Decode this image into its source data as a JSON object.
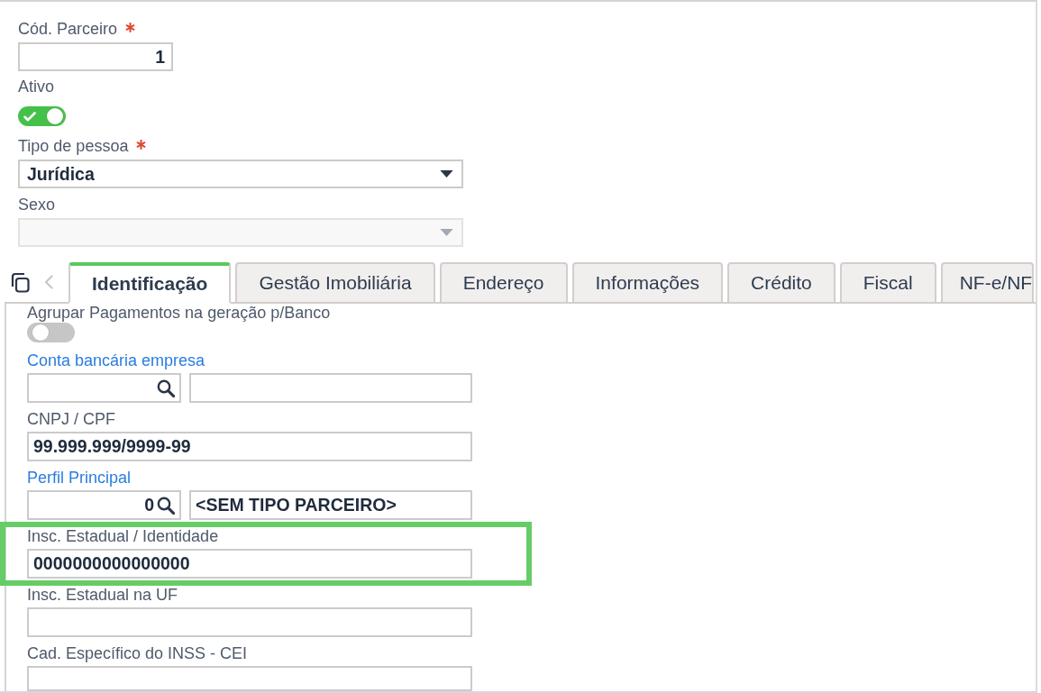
{
  "header_fields": [
    {
      "kind": "number",
      "label": "Cód. Parceiro",
      "required": true,
      "value": "1"
    },
    {
      "kind": "toggle",
      "label": "Ativo",
      "required": false,
      "on": true
    },
    {
      "kind": "select",
      "label": "Tipo de pessoa",
      "required": true,
      "value": "Jurídica",
      "disabled": false
    },
    {
      "kind": "select",
      "label": "Sexo",
      "required": false,
      "disabled": true
    }
  ],
  "tabs": [
    {
      "label": "Identificação",
      "selected": true
    },
    {
      "label": "Gestão Imobiliária",
      "selected": false
    },
    {
      "label": "Endereço",
      "selected": false
    },
    {
      "label": "Informações",
      "selected": false
    },
    {
      "label": "Crédito",
      "selected": false
    },
    {
      "label": "Fiscal",
      "selected": false
    },
    {
      "label": "NF-e/NF",
      "selected": false
    }
  ],
  "tab_fields": [
    {
      "kind": "toggle",
      "label": "Agrupar Pagamentos na geração p/Banco",
      "on": false,
      "highlighted": false
    },
    {
      "kind": "lookup",
      "label": "Conta bancária empresa",
      "highlighted": false
    },
    {
      "kind": "text",
      "label": "CNPJ / CPF",
      "value": "99.999.999/9999-99",
      "highlighted": false
    },
    {
      "kind": "lookup",
      "label": "Perfil Principal",
      "code": "0",
      "description": "<SEM TIPO PARCEIRO>",
      "highlighted": false
    },
    {
      "kind": "text",
      "label": "Insc. Estadual / Identidade",
      "value": "0000000000000000",
      "highlighted": true
    },
    {
      "kind": "text",
      "label": "Insc. Estadual na UF",
      "highlighted": false
    },
    {
      "kind": "text",
      "label": "Cad. Específico do INSS - CEI",
      "highlighted": false
    }
  ]
}
